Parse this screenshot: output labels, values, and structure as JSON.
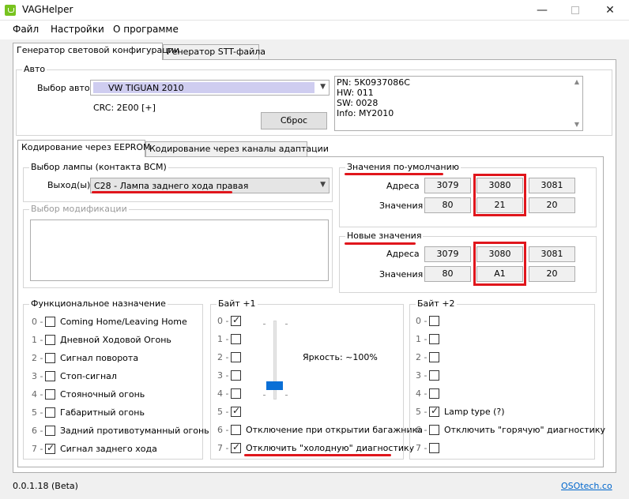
{
  "window": {
    "title": "VAGHelper"
  },
  "menu": {
    "file": "Файл",
    "settings": "Настройки",
    "about": "О программе"
  },
  "tabs": {
    "light_config": "Генератор световой конфигурации",
    "stt": "Генератор STT-файла"
  },
  "auto": {
    "title": "Авто",
    "select_label": "Выбор авто",
    "selected": "VW TIGUAN 2010",
    "crc": "CRC: 2E00 [+]",
    "reset": "Сброс",
    "info": [
      "PN: 5K0937086C",
      "HW: 011",
      "SW: 0028",
      "Info: MY2010"
    ]
  },
  "subtabs": {
    "eeprom": "Кодирование через EEPROM",
    "adapt": "Кодирование через каналы адаптации"
  },
  "lamp": {
    "title": "Выбор лампы (контакта BCM)",
    "output_label": "Выход(ы)",
    "output_value": "C28 - Лампа заднего хода правая"
  },
  "mod": {
    "title": "Выбор модификации"
  },
  "defaults": {
    "title": "Значения по-умолчанию",
    "addr_label": "Адреса",
    "val_label": "Значения",
    "addrs": [
      "3079",
      "3080",
      "3081"
    ],
    "vals": [
      "80",
      "21",
      "20"
    ]
  },
  "newvals": {
    "title": "Новые значения",
    "addr_label": "Адреса",
    "val_label": "Значения",
    "addrs": [
      "3079",
      "3080",
      "3081"
    ],
    "vals": [
      "80",
      "A1",
      "20"
    ]
  },
  "func": {
    "title": "Функциональное назначение",
    "items": [
      {
        "idx": "0 -",
        "label": "Coming Home/Leaving Home",
        "checked": false
      },
      {
        "idx": "1 -",
        "label": "Дневной Ходовой Огонь",
        "checked": false
      },
      {
        "idx": "2 -",
        "label": "Сигнал поворота",
        "checked": false
      },
      {
        "idx": "3 -",
        "label": "Стоп-сигнал",
        "checked": false
      },
      {
        "idx": "4 -",
        "label": "Стояночный огонь",
        "checked": false
      },
      {
        "idx": "5 -",
        "label": "Габаритный огонь",
        "checked": false
      },
      {
        "idx": "6 -",
        "label": "Задний противотуманный огонь",
        "checked": false
      },
      {
        "idx": "7 -",
        "label": "Сигнал заднего хода",
        "checked": true
      }
    ]
  },
  "byte1": {
    "title": "Байт +1",
    "brightness": "Яркость: ~100%",
    "items": [
      {
        "idx": "0 -",
        "label": "",
        "checked": true
      },
      {
        "idx": "1 -",
        "label": "",
        "checked": false
      },
      {
        "idx": "2 -",
        "label": "",
        "checked": false
      },
      {
        "idx": "3 -",
        "label": "",
        "checked": false
      },
      {
        "idx": "4 -",
        "label": "",
        "checked": false
      },
      {
        "idx": "5 -",
        "label": "",
        "checked": true
      },
      {
        "idx": "6 -",
        "label": "Отключение при открытии багажника",
        "checked": false
      },
      {
        "idx": "7 -",
        "label": "Отключить \"холодную\" диагностику",
        "checked": true
      }
    ]
  },
  "byte2": {
    "title": "Байт +2",
    "items": [
      {
        "idx": "0 -",
        "label": "",
        "checked": false
      },
      {
        "idx": "1 -",
        "label": "",
        "checked": false
      },
      {
        "idx": "2 -",
        "label": "",
        "checked": false
      },
      {
        "idx": "3 -",
        "label": "",
        "checked": false
      },
      {
        "idx": "4 -",
        "label": "",
        "checked": false
      },
      {
        "idx": "5 -",
        "label": "Lamp type (?)",
        "checked": true
      },
      {
        "idx": "6 -",
        "label": "Отключить \"горячую\" диагностику",
        "checked": false
      },
      {
        "idx": "7 -",
        "label": "",
        "checked": false
      }
    ]
  },
  "status": {
    "version": "0.0.1.18 (Beta)",
    "link": "OSOtech.co"
  },
  "colors": {
    "accent_red": "#e0161c",
    "link_blue": "#0066cc",
    "slider_blue": "#0a6fd6"
  }
}
